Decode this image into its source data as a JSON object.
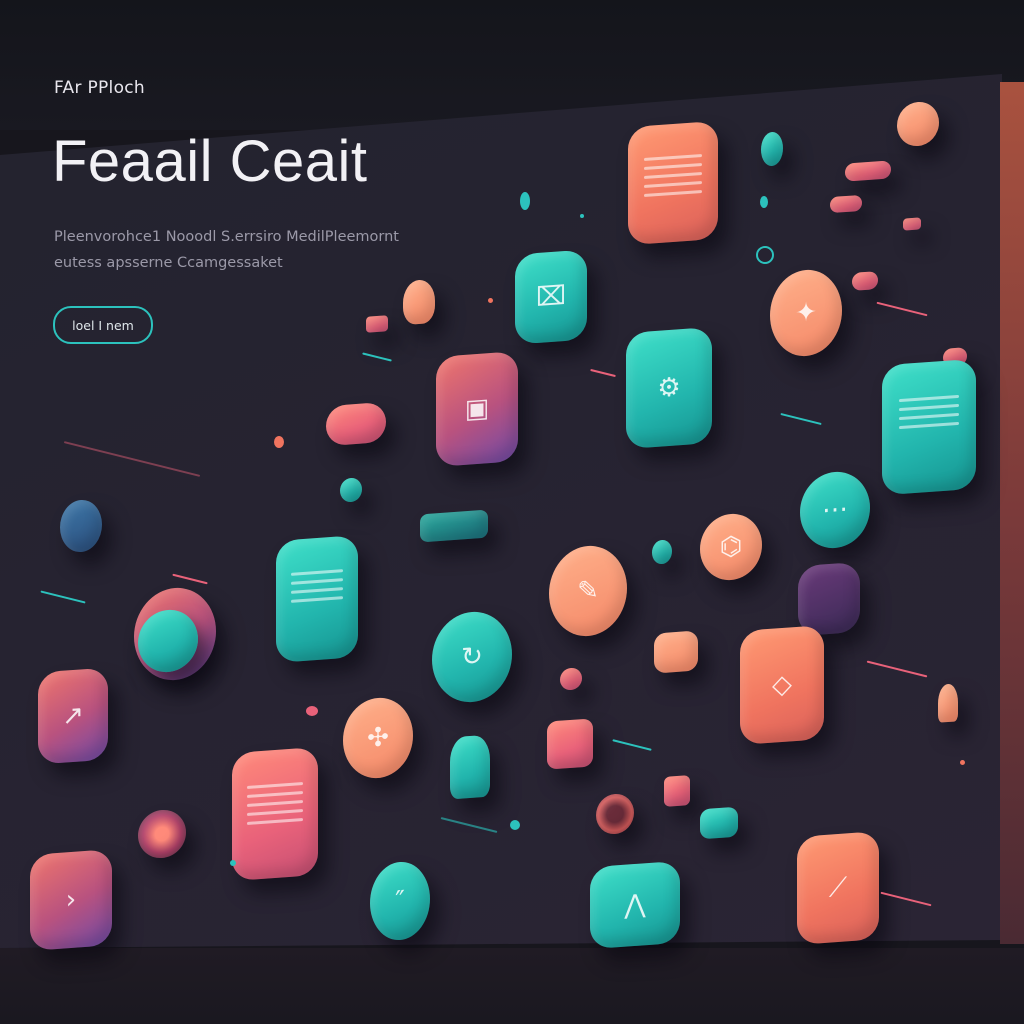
{
  "hero": {
    "brand": "FAr PPloch",
    "title": "Feaail Ceait",
    "subtitle_line1": "Pleenvorohce1 Nooodl S.errsiro MedilPleemornt",
    "subtitle_line2": "eutess apsserne Ccamgessaket",
    "cta_label": "loel I nem"
  },
  "colors": {
    "background": "#17161d",
    "panel": "#252330",
    "accent_teal": "#2cc2bd",
    "accent_coral": "#f0745f",
    "accent_pink": "#e9627a",
    "accent_peach": "#ffb08a",
    "text_primary": "#f2f1f5",
    "text_muted": "#9b99a8"
  },
  "scene": {
    "icons": [
      "document-icon",
      "image-frame-icon",
      "chip-icon",
      "gear-icon",
      "flame-icon",
      "crystal-icon",
      "drone-icon",
      "camera-icon",
      "cloud-icon",
      "planet-icon",
      "play-icon",
      "check-icon",
      "pencil-icon",
      "mountain-icon"
    ]
  }
}
